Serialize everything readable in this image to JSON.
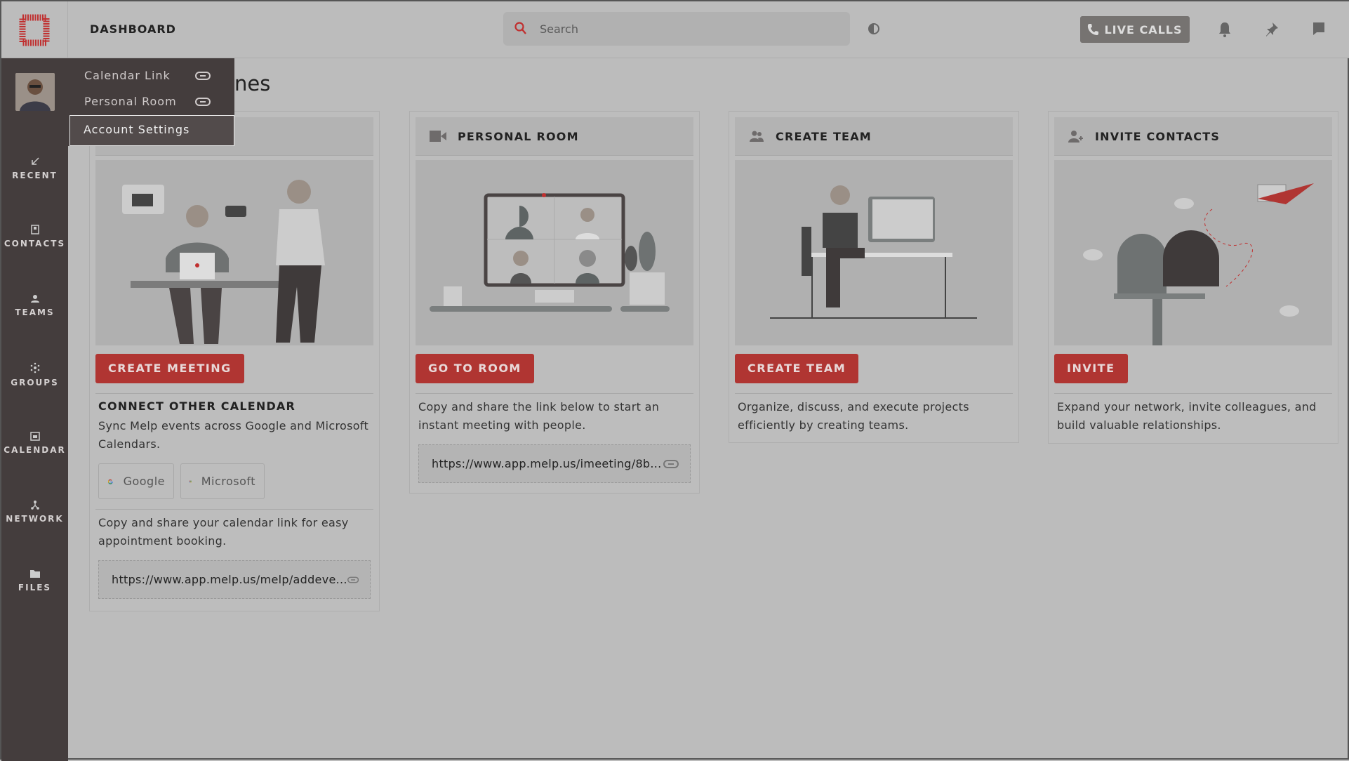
{
  "header": {
    "title": "DASHBOARD",
    "search_placeholder": "Search",
    "live_calls": "LIVE CALLS",
    "icons": [
      "search-icon",
      "theme-icon",
      "phone-icon",
      "bell-icon",
      "pin-icon",
      "chat-icon"
    ]
  },
  "sidebar": {
    "items": [
      {
        "label": "RECENT",
        "icon": "recent-arrow-icon"
      },
      {
        "label": "CONTACTS",
        "icon": "contacts-icon"
      },
      {
        "label": "TEAMS",
        "icon": "teams-icon"
      },
      {
        "label": "GROUPS",
        "icon": "groups-icon"
      },
      {
        "label": "CALENDAR",
        "icon": "calendar-icon"
      },
      {
        "label": "NETWORK",
        "icon": "network-icon"
      },
      {
        "label": "FILES",
        "icon": "folder-icon"
      }
    ]
  },
  "profile_menu": {
    "items": [
      {
        "label": "Calendar Link",
        "icon": "link-icon"
      },
      {
        "label": "Personal Room",
        "icon": "link-icon"
      },
      {
        "label": "Account Settings"
      }
    ]
  },
  "page": {
    "title_visible": "nes"
  },
  "cards": [
    {
      "title": "",
      "button": "CREATE MEETING",
      "subtitle": "CONNECT OTHER CALENDAR",
      "text": "Sync Melp events across Google and Microsoft Calendars.",
      "calendars": [
        "Google",
        "Microsoft"
      ],
      "text2": "Copy and share your calendar link for easy appointment booking.",
      "link": "https://www.app.melp.us/melp/addeve..."
    },
    {
      "title": "PERSONAL ROOM",
      "icon": "video-camera-icon",
      "button": "GO TO ROOM",
      "text": "Copy and share the link below to start an instant meeting with people.",
      "link": "https://www.app.melp.us/imeeting/8b..."
    },
    {
      "title": "CREATE TEAM",
      "icon": "team-icon",
      "button": "CREATE TEAM",
      "text": "Organize, discuss, and execute projects efficiently by creating teams."
    },
    {
      "title": "INVITE CONTACTS",
      "icon": "add-user-icon",
      "button": "INVITE",
      "text": "Expand your network, invite colleagues, and build valuable relationships."
    }
  ],
  "colors": {
    "accent": "#b03532",
    "sidebar": "#443d3d",
    "overlay_bg": "#bcbcbc"
  }
}
